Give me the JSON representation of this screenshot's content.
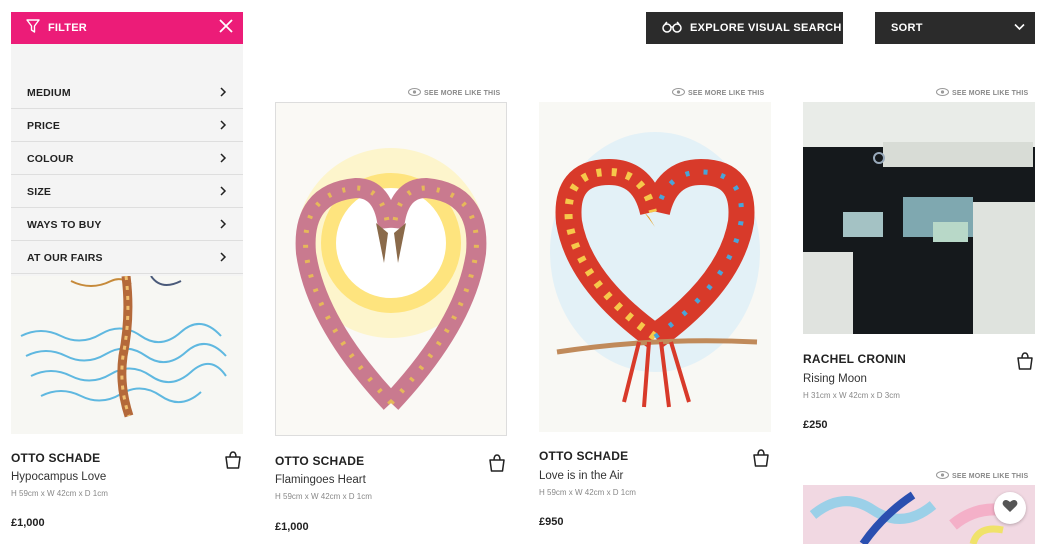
{
  "filter": {
    "title": "FILTER",
    "items": [
      {
        "label": "MEDIUM"
      },
      {
        "label": "PRICE"
      },
      {
        "label": "COLOUR"
      },
      {
        "label": "SIZE"
      },
      {
        "label": "WAYS TO BUY"
      },
      {
        "label": "AT OUR FAIRS"
      }
    ]
  },
  "toolbar": {
    "visual_search_label": "EXPLORE VISUAL SEARCH",
    "sort_label": "SORT"
  },
  "see_more_label": "SEE MORE LIKE THIS",
  "products": [
    {
      "artist": "OTTO SCHADE",
      "title": "Hypocampus Love",
      "dims": "H 59cm x W 42cm x D 1cm",
      "price": "£1,000"
    },
    {
      "artist": "OTTO SCHADE",
      "title": "Flamingoes Heart",
      "dims": "H 59cm x W 42cm x D 1cm",
      "price": "£1,000"
    },
    {
      "artist": "OTTO SCHADE",
      "title": "Love is in the Air",
      "dims": "H 59cm x W 42cm x D 1cm",
      "price": "£950"
    },
    {
      "artist": "RACHEL CRONIN",
      "title": "Rising Moon",
      "dims": "H 31cm x W 42cm x D 3cm",
      "price": "£250"
    }
  ],
  "colors": {
    "accent": "#ec1c78",
    "dark": "#2b2b2b"
  }
}
